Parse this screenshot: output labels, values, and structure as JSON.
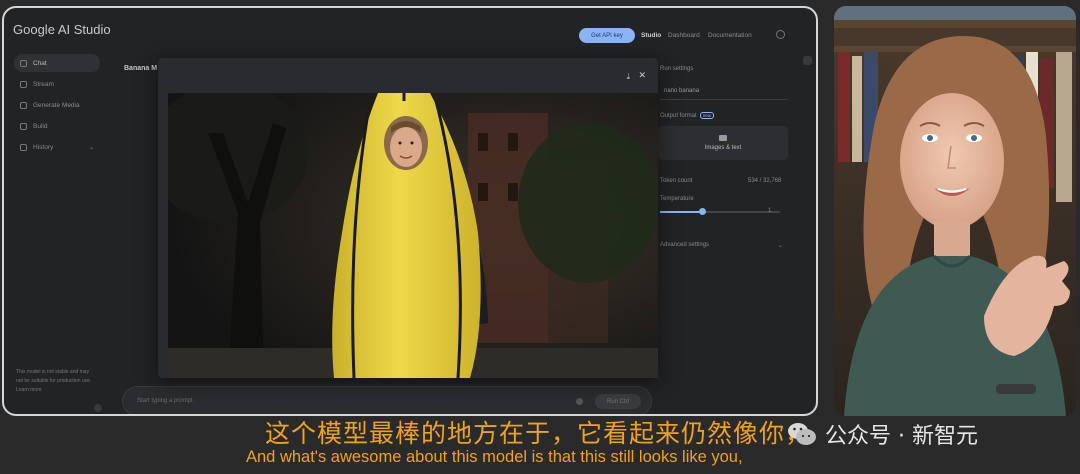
{
  "app": {
    "title": "Google AI Studio",
    "sidebar": [
      {
        "label": "Chat",
        "icon": "chat-icon",
        "active": true
      },
      {
        "label": "Stream",
        "icon": "stream-icon"
      },
      {
        "label": "Generate Media",
        "icon": "media-icon"
      },
      {
        "label": "Build",
        "icon": "build-icon"
      },
      {
        "label": "History",
        "icon": "history-icon"
      }
    ],
    "sidebar_note": "This model is not stable and may not be suitable for production use. Learn more",
    "header": {
      "api_key_button": "Get API key",
      "links": [
        "Studio",
        "Dashboard",
        "Documentation"
      ]
    },
    "chat_title": "Banana M",
    "prompt": {
      "placeholder": "Start typing a prompt",
      "run_label": "Run Ctrl"
    },
    "settings": {
      "title": "Run settings",
      "model_value": "nano banana",
      "output_format_label": "Output format",
      "output_format_badge": "new",
      "output_format_value": "Images & text",
      "token_count_label": "Token count",
      "token_count_value": "534 / 32,768",
      "temperature_label": "Temperature",
      "temperature_value": "1",
      "temperature_fraction": 0.35,
      "advanced_label": "Advanced settings"
    }
  },
  "subtitles": {
    "zh": "这个模型最棒的地方在于，它看起来仍然像你，",
    "en": "And what's awesome about this model is that this still looks like you,"
  },
  "watermark": "公众号 · 新智元",
  "colors": {
    "subtitle": "#f0a21b",
    "accent": "#8ab4f8",
    "costume_yellow": "#e6cf3a"
  }
}
